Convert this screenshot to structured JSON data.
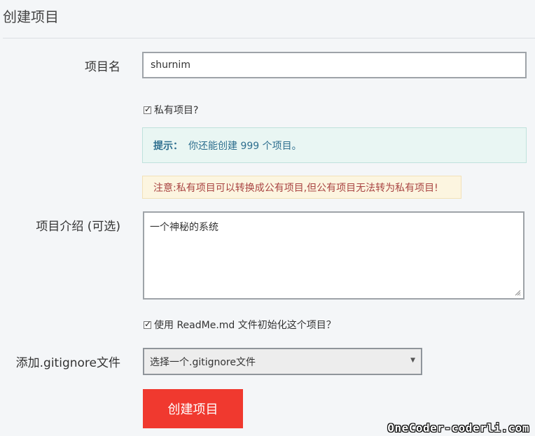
{
  "page": {
    "title": "创建项目"
  },
  "form": {
    "name_label": "项目名",
    "name_value": "shurnim",
    "private_label": "私有项目?",
    "private_checked": true,
    "tip_key": "提示：",
    "tip_text": "你还能创建 999 个项目。",
    "warning": "注意:私有项目可以转换成公有项目,但公有项目无法转为私有项目!",
    "desc_label": "项目介绍 (可选)",
    "desc_value": "一个神秘的系统",
    "readme_label": "使用 ReadMe.md 文件初始化这个项目？",
    "readme_checked": true,
    "gitignore_label": "添加.gitignore文件",
    "gitignore_selected": "选择一个.gitignore文件",
    "submit_label": "创建项目"
  },
  "watermark": "OneCoder-coderli.com",
  "colors": {
    "primary_button": "#f0392f",
    "tip_background": "#e9f6f3",
    "tip_text": "#2e6f8f",
    "warning_background": "#fcf5e0",
    "warning_text": "#a94442"
  }
}
